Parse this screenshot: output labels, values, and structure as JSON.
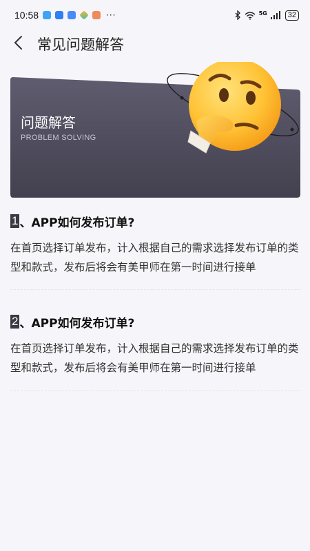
{
  "status_bar": {
    "time": "10:58",
    "dots": "···",
    "signal_label": "5G",
    "battery": "32"
  },
  "header": {
    "title": "常见问题解答"
  },
  "banner": {
    "title": "问题解答",
    "subtitle": "PROBLEM SOLVING"
  },
  "faqs": [
    {
      "number": "1",
      "separator": "、",
      "question": "APP如何发布订单?",
      "answer": "在首页选择订单发布，计入根据自己的需求选择发布订单的类型和款式，发布后将会有美甲师在第一时间进行接单"
    },
    {
      "number": "2",
      "separator": "、",
      "question": "APP如何发布订单?",
      "answer": "在首页选择订单发布，计入根据自己的需求选择发布订单的类型和款式，发布后将会有美甲师在第一时间进行接单"
    }
  ]
}
